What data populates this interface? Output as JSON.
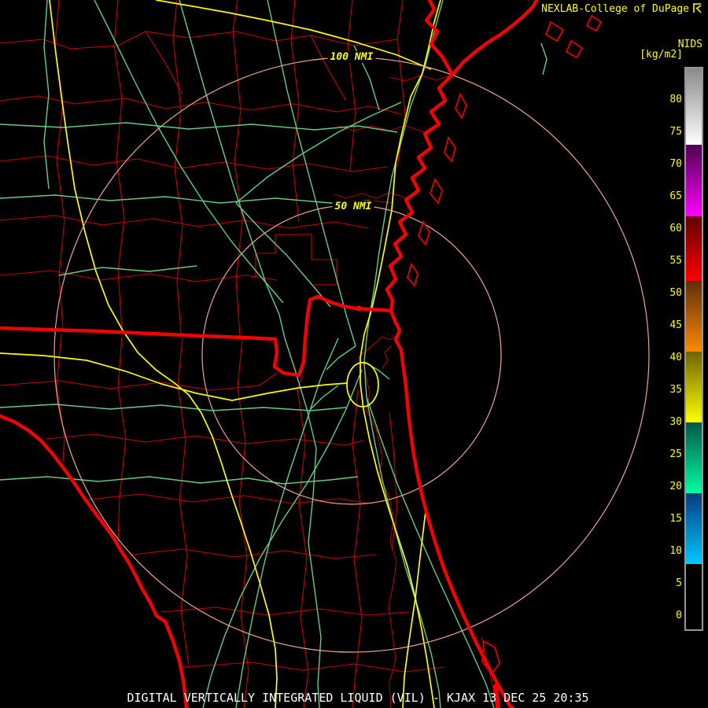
{
  "header": {
    "source_credit": "NEXLAB-College of DuPage",
    "scale_name": "NIDS",
    "scale_units": "[kg/m2]"
  },
  "footer": {
    "product_title": "DIGITAL VERTICALLY INTEGRATED LIQUID (VIL) - KJAX 13 DEC 25 20:35"
  },
  "map": {
    "range_ring_labels": {
      "outer": "100 NMI",
      "inner": "50 NMI"
    },
    "colors": {
      "county": "#c80000",
      "major_border": "#f40000",
      "road_secondary": "#66cc88",
      "road_interstate": "#ffff00",
      "range_ring": "#eca68f",
      "river": "#cc0000"
    }
  },
  "colorbar": {
    "border_color": "#969696",
    "tick_values": [
      80,
      75,
      70,
      65,
      60,
      55,
      50,
      45,
      40,
      35,
      30,
      25,
      20,
      15,
      10,
      5,
      0
    ],
    "segments": [
      {
        "hi": 84.88,
        "lo": 73,
        "top": "#8a8a8a",
        "bottom": "#ffffff"
      },
      {
        "hi": 73,
        "lo": 62,
        "top": "#4e004e",
        "bottom": "#ff00ff"
      },
      {
        "hi": 62,
        "lo": 52,
        "top": "#600000",
        "bottom": "#ff0000"
      },
      {
        "hi": 52,
        "lo": 41,
        "top": "#5e2e08",
        "bottom": "#ff8806"
      },
      {
        "hi": 41,
        "lo": 30,
        "top": "#6e6400",
        "bottom": "#ffff00"
      },
      {
        "hi": 30,
        "lo": 19,
        "top": "#00584a",
        "bottom": "#00ffa0"
      },
      {
        "hi": 19,
        "lo": 8,
        "top": "#073c7e",
        "bottom": "#00c8ff"
      },
      {
        "hi": 8,
        "lo": -2.07,
        "top": "#000000",
        "bottom": "#000000"
      }
    ]
  }
}
